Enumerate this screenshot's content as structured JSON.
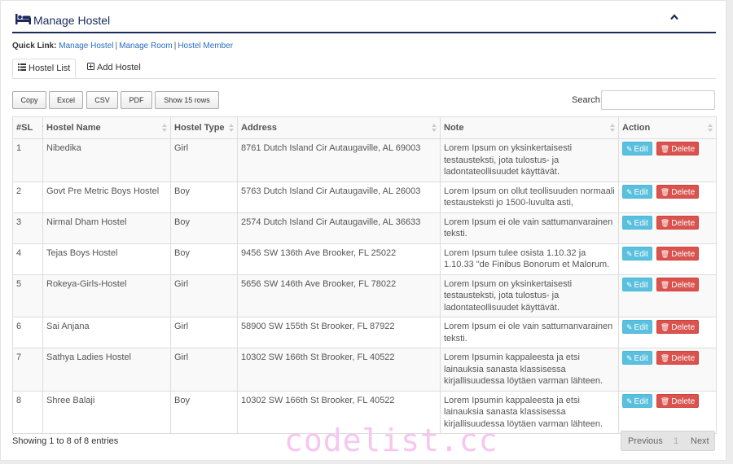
{
  "header": {
    "title": "Manage Hostel",
    "icon": "bed-icon",
    "collapse_icon": "chevron-up-icon",
    "accent_color": "#1b2a5e"
  },
  "quick_link": {
    "label": "Quick Link:",
    "links": [
      "Manage Hostel",
      "Manage Room",
      "Hostel Member"
    ],
    "separator": "|"
  },
  "tabs": [
    {
      "label": "Hostel List",
      "icon": "list-icon",
      "active": true
    },
    {
      "label": "Add Hostel",
      "icon": "plus-square-icon",
      "active": false
    }
  ],
  "toolbar": {
    "buttons": [
      "Copy",
      "Excel",
      "CSV",
      "PDF",
      "Show 15 rows"
    ]
  },
  "search": {
    "label": "Search:",
    "value": ""
  },
  "table": {
    "columns": [
      "#SL",
      "Hostel Name",
      "Hostel Type",
      "Address",
      "Note",
      "Action"
    ],
    "rows": [
      [
        "1",
        "Nibedika",
        "Girl",
        "8761 Dutch Island Cir Autaugaville, AL 69003",
        "Lorem Ipsum on yksinkertaisesti testausteksti, jota tulostus- ja ladontateollisuudet käyttävät."
      ],
      [
        "2",
        "Govt Pre Metric Boys Hostel",
        "Boy",
        "5763 Dutch Island Cir Autaugaville, AL 26003",
        "Lorem Ipsum on ollut teollisuuden normaali testausteksti jo 1500-luvulta asti,"
      ],
      [
        "3",
        "Nirmal Dham Hostel",
        "Boy",
        "2574 Dutch Island Cir Autaugaville, AL 36633",
        "Lorem Ipsum ei ole vain sattumanvarainen teksti."
      ],
      [
        "4",
        "Tejas Boys Hostel",
        "Boy",
        "9456 SW 136th Ave Brooker, FL 25022",
        "Lorem Ipsum tulee osista 1.10.32 ja 1.10.33 \"de Finibus Bonorum et Malorum."
      ],
      [
        "5",
        "Rokeya-Girls-Hostel",
        "Girl",
        "5656 SW 146th Ave Brooker, FL 78022",
        "Lorem Ipsum on yksinkertaisesti testausteksti, jota tulostus- ja ladontateollisuudet käyttävät."
      ],
      [
        "6",
        "Sai Anjana",
        "Girl",
        "58900 SW 155th St Brooker, FL 87922",
        "Lorem Ipsum ei ole vain sattumanvarainen teksti."
      ],
      [
        "7",
        "Sathya Ladies Hostel",
        "Girl",
        "10302 SW 166th St Brooker, FL 40522",
        "Lorem Ipsumin kappaleesta ja etsi lainauksia sanasta klassisessa kirjallisuudessa löytäen varman lähteen."
      ],
      [
        "8",
        "Shree Balaji",
        "Boy",
        "10302 SW 166th St Brooker, FL 40522",
        "Lorem Ipsumin kappaleesta ja etsi lainauksia sanasta klassisessa kirjallisuudessa löytäen varman lähteen."
      ]
    ],
    "row_actions": {
      "edit": "Edit",
      "delete": "Delete",
      "edit_icon": "pencil-square-icon",
      "delete_icon": "trash-icon"
    }
  },
  "footer": {
    "info": "Showing 1 to 8 of 8 entries",
    "prev": "Previous",
    "page": "1",
    "next": "Next"
  },
  "watermark": "codelist.cc"
}
